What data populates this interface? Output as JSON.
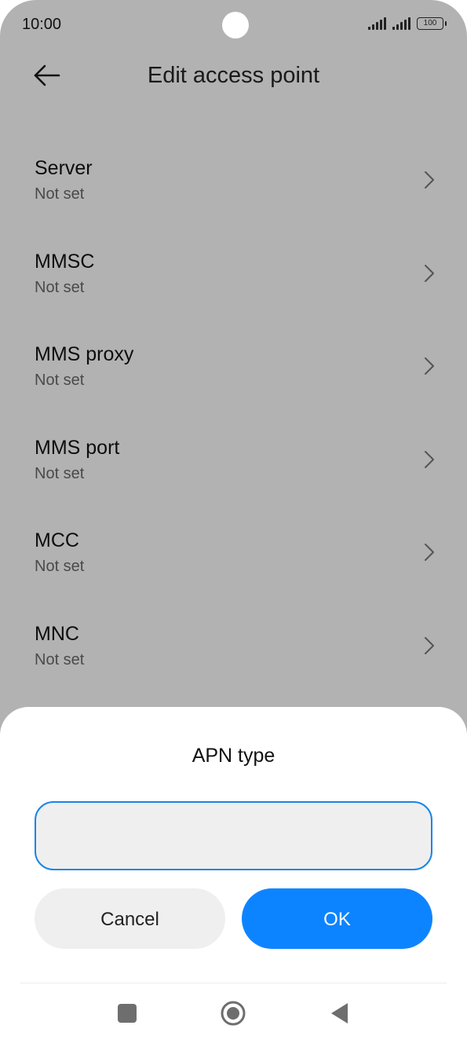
{
  "status_bar": {
    "time": "10:00",
    "battery": "100",
    "icons": [
      "signal-icon",
      "signal-icon",
      "battery-icon"
    ]
  },
  "header": {
    "title": "Edit access point",
    "back_icon": "back-arrow-icon"
  },
  "settings": {
    "items": [
      {
        "title": "Server",
        "value": "Not set"
      },
      {
        "title": "MMSC",
        "value": "Not set"
      },
      {
        "title": "MMS proxy",
        "value": "Not set"
      },
      {
        "title": "MMS port",
        "value": "Not set"
      },
      {
        "title": "MCC",
        "value": "Not set"
      },
      {
        "title": "MNC",
        "value": "Not set"
      }
    ],
    "chevron_icon": "chevron-right-icon"
  },
  "dialog": {
    "title": "APN type",
    "input_value": "",
    "cancel_label": "Cancel",
    "ok_label": "OK"
  },
  "navigation": {
    "icons": [
      "recents-square-icon",
      "home-circle-icon",
      "back-triangle-icon"
    ]
  },
  "colors": {
    "accent": "#0d84ff",
    "input_border": "#1a85e6",
    "dimmed_background": "#b2b2b2",
    "sheet_background": "#ffffff"
  }
}
